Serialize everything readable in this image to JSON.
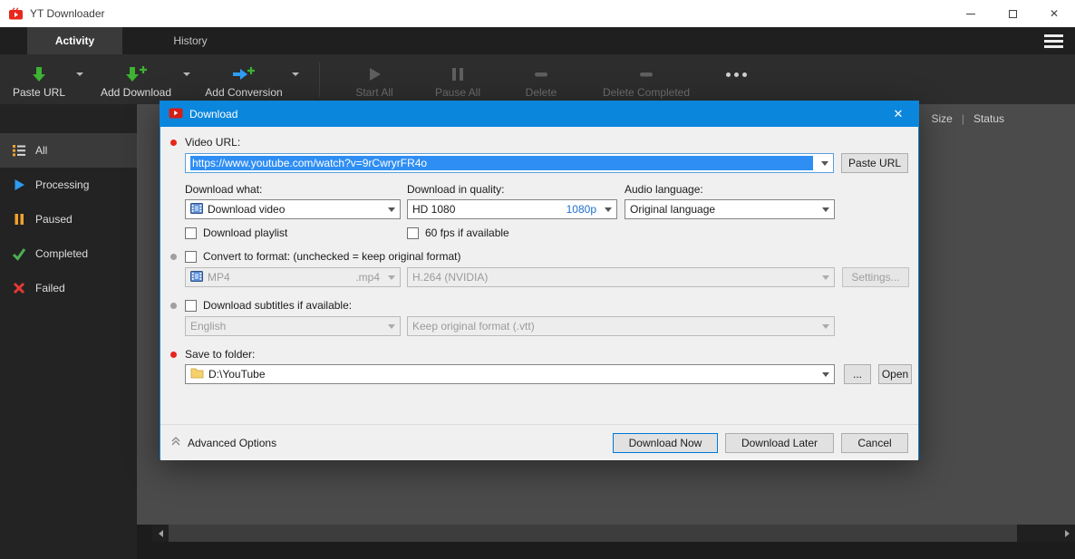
{
  "window": {
    "title": "YT Downloader"
  },
  "tabs": {
    "activity": "Activity",
    "history": "History"
  },
  "toolbar": {
    "paste_url": "Paste URL",
    "add_download": "Add Download",
    "add_conversion": "Add Conversion",
    "start_all": "Start All",
    "pause_all": "Pause All",
    "delete": "Delete",
    "delete_completed": "Delete Completed"
  },
  "sidebar": {
    "all": "All",
    "processing": "Processing",
    "paused": "Paused",
    "completed": "Completed",
    "failed": "Failed"
  },
  "list": {
    "header_size": "Size",
    "header_status": "Status"
  },
  "dialog": {
    "title": "Download",
    "url_label": "Video URL:",
    "url_value": "https://www.youtube.com/watch?v=9rCwryrFR4o",
    "paste_url_button": "Paste URL",
    "what_label": "Download what:",
    "what_value": "Download video",
    "quality_label": "Download in quality:",
    "quality_value": "HD 1080",
    "quality_badge": "1080p",
    "audio_label": "Audio language:",
    "audio_value": "Original language",
    "playlist_checkbox": "Download playlist",
    "fps_checkbox": "60 fps if available",
    "convert_checkbox": "Convert to format: (unchecked = keep original format)",
    "format_value": "MP4",
    "format_ext": ".mp4",
    "codec_value": "H.264 (NVIDIA)",
    "settings_button": "Settings...",
    "subtitles_checkbox": "Download subtitles if available:",
    "subtitle_lang_value": "English",
    "subtitle_format_value": "Keep original format (.vtt)",
    "folder_label": "Save to folder:",
    "folder_value": "D:\\YouTube",
    "browse_button": "...",
    "open_button": "Open",
    "advanced_options": "Advanced Options",
    "download_now": "Download Now",
    "download_later": "Download Later",
    "cancel": "Cancel"
  }
}
